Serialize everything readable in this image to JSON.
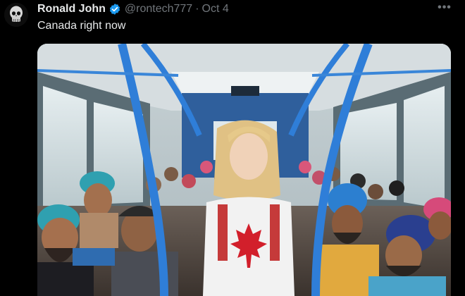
{
  "tweet": {
    "author_name": "Ronald John",
    "handle": "@rontech777",
    "separator": "·",
    "date": "Oct 4",
    "text": "Canada right now",
    "more_label": "•••",
    "verified_icon": "verified-badge-icon",
    "avatar_icon": "skull-avatar",
    "verified_color": "#1d9bf0"
  }
}
